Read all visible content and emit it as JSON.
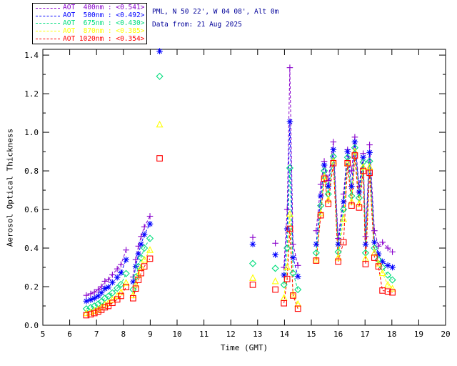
{
  "header": {
    "line1": "PML, N 50 22', W 04 08', Alt 0m",
    "line2": "Data from: 21 Aug 2025"
  },
  "chart_data": {
    "type": "line",
    "title": "",
    "xlabel": "Time (GMT)",
    "ylabel": "Aerosol Optical Thickness",
    "xlim": [
      5,
      20
    ],
    "ylim": [
      0,
      1.43
    ],
    "xticks": [
      5,
      6,
      7,
      8,
      9,
      10,
      11,
      12,
      13,
      14,
      15,
      16,
      17,
      18,
      19,
      20
    ],
    "xtick_labels": [
      "5",
      "6",
      "7",
      "8",
      "9",
      "10",
      "11",
      "12",
      "13",
      "14",
      "15",
      "16",
      "17",
      "18",
      "19",
      "20"
    ],
    "yticks": [
      0.0,
      0.2,
      0.4,
      0.6,
      0.8,
      1.0,
      1.2,
      1.4
    ],
    "ytick_labels": [
      "0.0",
      "0.2",
      "0.4",
      "0.6",
      "0.8",
      "1.0",
      "1.2",
      "1.4"
    ],
    "y_minor_step": 0.1,
    "grid": false,
    "legend_position": "top-left",
    "line_style": "dashed",
    "series": [
      {
        "name": "AOT 400nm",
        "wavelength_nm": 400,
        "daily_mean": 0.541,
        "legend_label": "AOT  400nm : <0.541>",
        "color": "#8800cc",
        "marker": "plus",
        "segments": [
          {
            "t": [
              6.62,
              6.78,
              6.92,
              7.06,
              7.18,
              7.31,
              7.44,
              7.59,
              7.77,
              7.91,
              8.1
            ],
            "v": [
              0.155,
              0.163,
              0.172,
              0.185,
              0.2,
              0.228,
              0.236,
              0.262,
              0.292,
              0.315,
              0.39
            ]
          },
          {
            "t": [
              8.36,
              8.46,
              8.56,
              8.66,
              8.78,
              8.99
            ],
            "v": [
              0.25,
              0.34,
              0.41,
              0.46,
              0.51,
              0.565
            ]
          },
          {
            "t": [
              12.82
            ],
            "v": [
              0.455
            ]
          },
          {
            "t": [
              13.66
            ],
            "v": [
              0.425
            ]
          },
          {
            "t": [
              13.98,
              14.1,
              14.2,
              14.32,
              14.5
            ],
            "v": [
              0.3,
              0.6,
              1.335,
              0.42,
              0.31
            ]
          },
          {
            "t": [
              15.18,
              15.35,
              15.48,
              15.63,
              15.82,
              16.0,
              16.2,
              16.35,
              16.5,
              16.62,
              16.78,
              16.93,
              17.02,
              17.17,
              17.35,
              17.5,
              17.65,
              17.85,
              18.02
            ],
            "v": [
              0.49,
              0.73,
              0.85,
              0.75,
              0.95,
              0.45,
              0.68,
              0.91,
              0.8,
              0.975,
              0.72,
              0.89,
              0.46,
              0.935,
              0.49,
              0.41,
              0.43,
              0.4,
              0.38
            ]
          }
        ]
      },
      {
        "name": "AOT 500nm",
        "wavelength_nm": 500,
        "daily_mean": 0.492,
        "legend_label": "AOT  500nm : <0.492>",
        "color": "#0000ff",
        "marker": "asterisk",
        "segments": [
          {
            "t": [
              6.62,
              6.78,
              6.92,
              7.06,
              7.18,
              7.31,
              7.44,
              7.59,
              7.77,
              7.91,
              8.1
            ],
            "v": [
              0.125,
              0.132,
              0.14,
              0.152,
              0.168,
              0.19,
              0.198,
              0.222,
              0.248,
              0.272,
              0.34
            ]
          },
          {
            "t": [
              8.36,
              8.46,
              8.56,
              8.66,
              8.78,
              8.99
            ],
            "v": [
              0.225,
              0.305,
              0.37,
              0.42,
              0.47,
              0.525
            ]
          },
          {
            "t": [
              9.35
            ],
            "v": [
              1.42
            ]
          },
          {
            "t": [
              12.82
            ],
            "v": [
              0.42
            ]
          },
          {
            "t": [
              13.66
            ],
            "v": [
              0.365
            ]
          },
          {
            "t": [
              13.98,
              14.1,
              14.2,
              14.32,
              14.5
            ],
            "v": [
              0.26,
              0.5,
              1.055,
              0.35,
              0.253
            ]
          },
          {
            "t": [
              15.18,
              15.35,
              15.48,
              15.63,
              15.82,
              16.0,
              16.2,
              16.35,
              16.5,
              16.62,
              16.78,
              16.93,
              17.02,
              17.17,
              17.35,
              17.5,
              17.65,
              17.85,
              18.02
            ],
            "v": [
              0.42,
              0.67,
              0.83,
              0.72,
              0.91,
              0.42,
              0.64,
              0.9,
              0.72,
              0.95,
              0.69,
              0.87,
              0.42,
              0.895,
              0.43,
              0.37,
              0.33,
              0.31,
              0.3
            ]
          }
        ]
      },
      {
        "name": "AOT 675nm",
        "wavelength_nm": 675,
        "daily_mean": 0.43,
        "legend_label": "AOT  675nm : <0.430>",
        "color": "#00dd7d",
        "marker": "diamond",
        "segments": [
          {
            "t": [
              6.62,
              6.78,
              6.92,
              7.06,
              7.18,
              7.31,
              7.44,
              7.59,
              7.77,
              7.91,
              8.1
            ],
            "v": [
              0.085,
              0.092,
              0.1,
              0.11,
              0.122,
              0.14,
              0.15,
              0.168,
              0.192,
              0.212,
              0.268
            ]
          },
          {
            "t": [
              8.36,
              8.46,
              8.56,
              8.66,
              8.78,
              8.99
            ],
            "v": [
              0.185,
              0.25,
              0.305,
              0.35,
              0.4,
              0.45
            ]
          },
          {
            "t": [
              9.35
            ],
            "v": [
              1.29
            ]
          },
          {
            "t": [
              12.82
            ],
            "v": [
              0.32
            ]
          },
          {
            "t": [
              13.66
            ],
            "v": [
              0.295
            ]
          },
          {
            "t": [
              13.98,
              14.1,
              14.2,
              14.32,
              14.5
            ],
            "v": [
              0.21,
              0.4,
              0.815,
              0.27,
              0.185
            ]
          },
          {
            "t": [
              15.18,
              15.35,
              15.48,
              15.63,
              15.82,
              16.0,
              16.2,
              16.35,
              16.5,
              16.62,
              16.78,
              16.93,
              17.02,
              17.17,
              17.35,
              17.5,
              17.65,
              17.85,
              18.02
            ],
            "v": [
              0.375,
              0.62,
              0.8,
              0.68,
              0.875,
              0.38,
              0.6,
              0.87,
              0.67,
              0.92,
              0.66,
              0.845,
              0.375,
              0.85,
              0.4,
              0.34,
              0.3,
              0.26,
              0.235
            ]
          }
        ]
      },
      {
        "name": "AOT 870nm",
        "wavelength_nm": 870,
        "daily_mean": 0.385,
        "legend_label": "AOT  870nm : <0.385>",
        "color": "#ffff00",
        "marker": "triangle",
        "segments": [
          {
            "t": [
              6.62,
              6.78,
              6.92,
              7.06,
              7.18,
              7.31,
              7.44,
              7.59,
              7.77,
              7.91,
              8.1
            ],
            "v": [
              0.062,
              0.068,
              0.075,
              0.083,
              0.093,
              0.107,
              0.115,
              0.132,
              0.152,
              0.17,
              0.22
            ]
          },
          {
            "t": [
              8.36,
              8.46,
              8.56,
              8.66,
              8.78,
              8.99
            ],
            "v": [
              0.155,
              0.21,
              0.26,
              0.3,
              0.34,
              0.39
            ]
          },
          {
            "t": [
              9.35
            ],
            "v": [
              1.04
            ]
          },
          {
            "t": [
              12.82
            ],
            "v": [
              0.245
            ]
          },
          {
            "t": [
              13.66
            ],
            "v": [
              0.228
            ]
          },
          {
            "t": [
              13.98,
              14.1,
              14.2,
              14.32,
              14.5
            ],
            "v": [
              0.142,
              0.3,
              0.575,
              0.16,
              0.11
            ]
          },
          {
            "t": [
              15.18,
              15.35,
              15.48,
              15.63,
              15.82,
              16.0,
              16.2,
              16.35,
              16.5,
              16.62,
              16.78,
              16.93,
              17.02,
              17.17,
              17.35,
              17.5,
              17.65,
              17.85,
              18.02
            ],
            "v": [
              0.34,
              0.58,
              0.77,
              0.65,
              0.85,
              0.35,
              0.55,
              0.84,
              0.64,
              0.9,
              0.63,
              0.82,
              0.345,
              0.82,
              0.375,
              0.32,
              0.27,
              0.21,
              0.19
            ]
          }
        ]
      },
      {
        "name": "AOT 1020nm",
        "wavelength_nm": 1020,
        "daily_mean": 0.354,
        "legend_label": "AOT 1020nm : <0.354>",
        "color": "#ff0000",
        "marker": "square",
        "segments": [
          {
            "t": [
              6.62,
              6.78,
              6.92,
              7.06,
              7.18,
              7.31,
              7.44,
              7.59,
              7.77,
              7.91,
              8.1
            ],
            "v": [
              0.052,
              0.057,
              0.063,
              0.071,
              0.08,
              0.093,
              0.1,
              0.116,
              0.134,
              0.152,
              0.198
            ]
          },
          {
            "t": [
              8.36,
              8.46,
              8.56,
              8.66,
              8.78,
              8.99
            ],
            "v": [
              0.14,
              0.19,
              0.235,
              0.27,
              0.305,
              0.345
            ]
          },
          {
            "t": [
              9.35
            ],
            "v": [
              0.865
            ]
          },
          {
            "t": [
              12.82
            ],
            "v": [
              0.21
            ]
          },
          {
            "t": [
              13.66
            ],
            "v": [
              0.185
            ]
          },
          {
            "t": [
              13.98,
              14.1,
              14.2,
              14.32,
              14.5
            ],
            "v": [
              0.114,
              0.24,
              0.5,
              0.154,
              0.086
            ]
          },
          {
            "t": [
              15.18,
              15.35,
              15.48,
              15.63,
              15.82,
              16.0,
              16.2,
              16.35,
              16.5,
              16.62,
              16.78,
              16.93,
              17.02,
              17.17,
              17.35,
              17.5,
              17.65,
              17.85,
              18.02
            ],
            "v": [
              0.335,
              0.57,
              0.76,
              0.63,
              0.84,
              0.33,
              0.43,
              0.84,
              0.62,
              0.88,
              0.61,
              0.8,
              0.317,
              0.79,
              0.35,
              0.305,
              0.18,
              0.175,
              0.17
            ]
          }
        ]
      }
    ]
  }
}
